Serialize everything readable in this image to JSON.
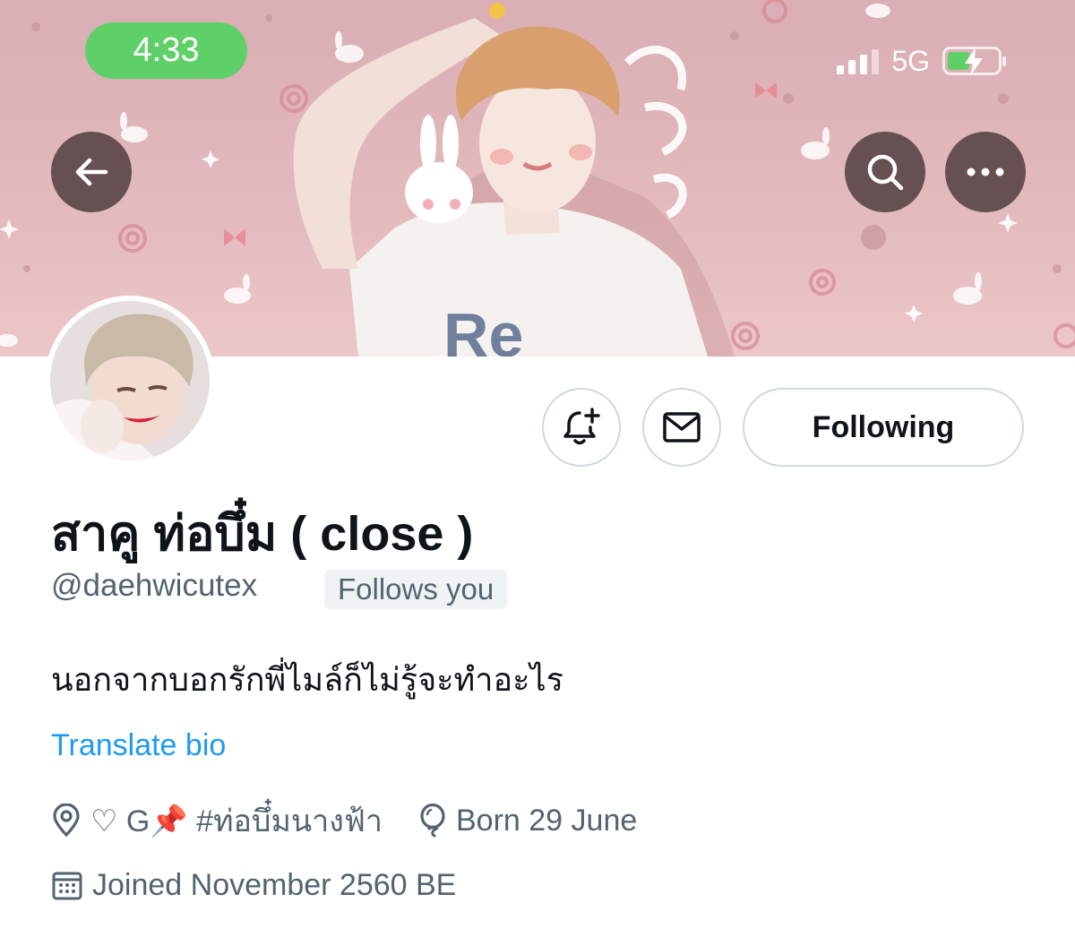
{
  "status_bar": {
    "time": "4:33",
    "network": "5G"
  },
  "nav": {
    "back_icon": "arrow-left-icon",
    "search_icon": "search-icon",
    "more_icon": "more-horizontal-icon"
  },
  "actions": {
    "notify_icon": "bell-plus-icon",
    "message_icon": "envelope-icon",
    "following_label": "Following"
  },
  "profile": {
    "display_name": "สาคู ท่อบึ๋ม ( close )",
    "handle": "@daehwicutex",
    "follows_you": "Follows you",
    "bio": "นอกจากบอกรักพี่ไมล์ก็ไม่รู้จะทำอะไร",
    "translate_label": "Translate bio",
    "location": "♡ G📌 #ท่อบึ๋มนางฟ้า",
    "birthday": "Born 29 June",
    "joined": "Joined November 2560 BE"
  },
  "colors": {
    "accent": "#1d9bf0",
    "secondary_text": "#536471",
    "status_green": "#5fd068"
  }
}
